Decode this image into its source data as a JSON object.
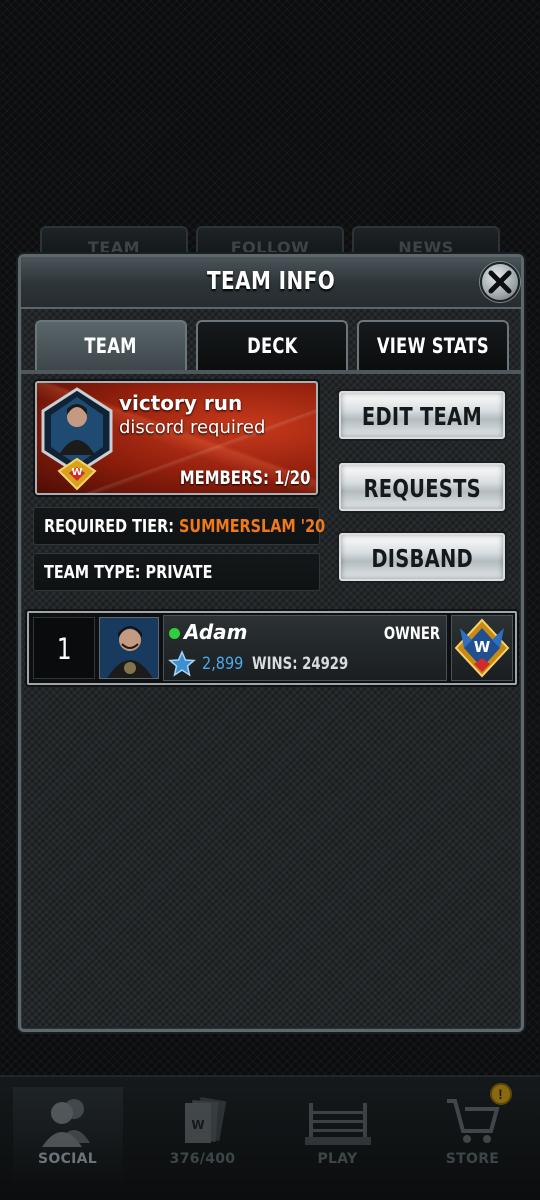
{
  "background": {
    "tabs": [
      "TEAM",
      "FOLLOW",
      "NEWS"
    ],
    "bottom_nav": [
      {
        "label": "SOCIAL",
        "icon": "social-icon",
        "active": true
      },
      {
        "label": "376/400",
        "icon": "cards-icon",
        "active": false
      },
      {
        "label": "PLAY",
        "icon": "ring-icon",
        "active": false
      },
      {
        "label": "STORE",
        "icon": "store-cart-icon",
        "active": false,
        "badge": "!"
      }
    ]
  },
  "modal": {
    "title": "TEAM INFO",
    "tabs": [
      {
        "label": "TEAM",
        "active": true
      },
      {
        "label": "DECK",
        "active": false
      },
      {
        "label": "VIEW STATS",
        "active": false
      }
    ],
    "team": {
      "name": "victory run",
      "description": "discord required",
      "members": "MEMBERS: 1/20",
      "required_tier_label": "REQUIRED TIER:",
      "required_tier_value": "SUMMERSLAM '20",
      "team_type": "TEAM TYPE: PRIVATE"
    },
    "buttons": {
      "edit": "EDIT TEAM",
      "requests": "REQUESTS",
      "disband": "DISBAND"
    },
    "members": [
      {
        "rank": "1",
        "name": "Adam",
        "online": true,
        "role": "OWNER",
        "score": "2,899",
        "wins": "WINS: 24929"
      }
    ]
  },
  "colors": {
    "tier_accent": "#f07a1a",
    "score_blue": "#4fa8e8",
    "online_green": "#2fd13a",
    "banner_red": "#c83a1c"
  }
}
